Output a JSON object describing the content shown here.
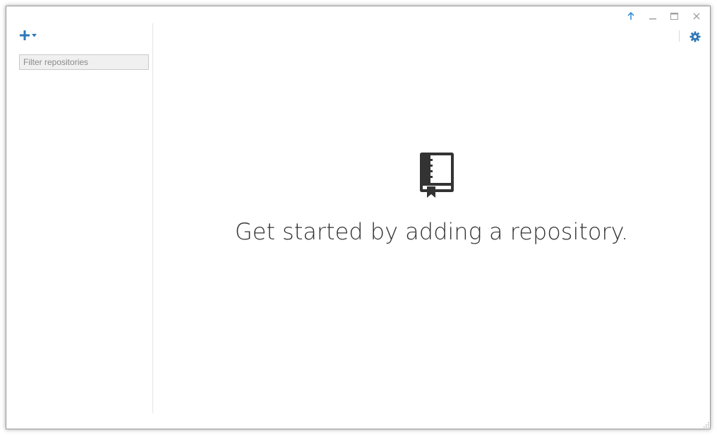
{
  "window": {
    "controls": [
      {
        "name": "update-icon"
      },
      {
        "name": "minimize-icon"
      },
      {
        "name": "maximize-icon"
      },
      {
        "name": "close-icon"
      }
    ]
  },
  "sidebar": {
    "filter": {
      "placeholder": "Filter repositories",
      "value": ""
    }
  },
  "toolbar": {
    "settings_icon": "gear-icon"
  },
  "main": {
    "empty_message": "Get started by adding a repository.",
    "icon": "repository-book-icon"
  },
  "colors": {
    "accent": "#2e77b8",
    "update_arrow": "#3b8fd6",
    "text": "#333333",
    "icon_dark": "#333333",
    "window_controls": "#a0a0a0"
  }
}
